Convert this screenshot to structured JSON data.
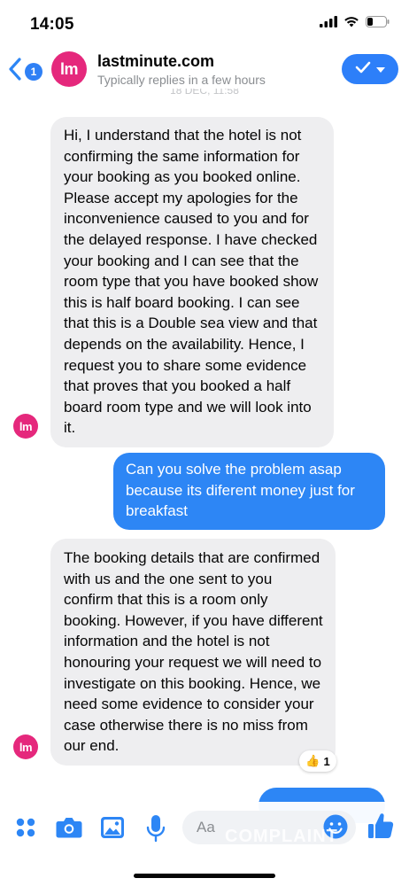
{
  "status": {
    "time": "14:05"
  },
  "header": {
    "back_count": "1",
    "avatar_text": "lm",
    "title": "lastminute.com",
    "subtitle": "Typically replies in a few hours",
    "date_peek": "18 DEC, 11:58"
  },
  "messages": [
    {
      "from": "lastminute.com",
      "direction": "incoming",
      "text": "Hi, I understand that the hotel is not confirming the same information for your booking as you booked online. Please accept my apologies for the inconvenience caused to you and for the delayed response. I have checked your booking and I can see that the room type that you have booked show this is half board booking. I can see that this is a Double sea view and that depends on the availability. Hence, I request you to share some evidence that proves that you booked a half board room type and we will look into it."
    },
    {
      "from": "me",
      "direction": "outgoing",
      "text": "Can you solve the problem asap because its diferent money just for breakfast"
    },
    {
      "from": "lastminute.com",
      "direction": "incoming",
      "text": "The booking details that are confirmed with us and the one sent to you confirm that this is a room only booking. However, if you have different information and the hotel is not honouring your request we will need to investigate on this booking. Hence, we need some evidence to consider your case otherwise there is no miss from our end.",
      "reaction": {
        "emoji": "👍",
        "count": "1"
      }
    },
    {
      "from": "me",
      "direction": "outgoing",
      "text": ""
    }
  ],
  "composer": {
    "placeholder": "Aa",
    "watermark": "COMPLAINT"
  },
  "icons": [
    "back-chevron-icon",
    "signal-icon",
    "wifi-icon",
    "battery-icon",
    "check-icon",
    "chevron-down-icon",
    "menu-dots-icon",
    "camera-icon",
    "photo-icon",
    "microphone-icon",
    "emoji-icon",
    "like-icon"
  ],
  "colors": {
    "accent": "#2d86f5",
    "brand": "#e5287c",
    "incoming_bubble": "#eeeef0"
  }
}
